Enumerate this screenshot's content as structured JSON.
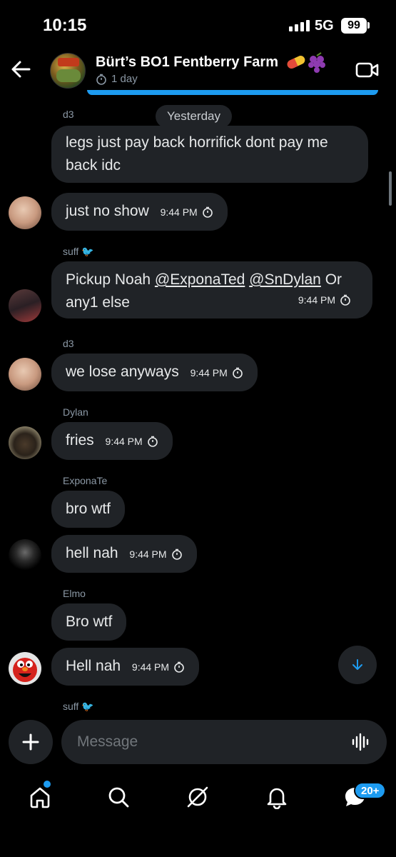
{
  "status_bar": {
    "time": "10:15",
    "network": "5G",
    "battery": "99"
  },
  "header": {
    "title": "Bürt’s BO1 Fentberry Farm",
    "subtitle": "1 day"
  },
  "date_separator": "Yesterday",
  "messages": [
    {
      "sender": "d3",
      "text": "legs just pay back horrifick dont pay me back idc"
    },
    {
      "text": "just no show",
      "time": "9:44 PM"
    },
    {
      "sender": "suff",
      "text_parts": [
        "Pickup Noah ",
        "@ExponaTed",
        " ",
        "@SnDylan",
        " Or any1 else"
      ],
      "time": "9:44 PM"
    },
    {
      "sender": "d3",
      "text": "we lose anyways",
      "time": "9:44 PM"
    },
    {
      "sender": "Dylan",
      "text": "fries",
      "time": "9:44 PM"
    },
    {
      "sender": "ExponaTe",
      "text": "bro wtf"
    },
    {
      "text": "hell nah",
      "time": "9:44 PM"
    },
    {
      "sender": "Elmo",
      "text": "Bro wtf"
    },
    {
      "text": "Hell nah",
      "time": "9:44 PM"
    },
    {
      "sender": "suff"
    }
  ],
  "composer": {
    "placeholder": "Message"
  },
  "tab_bar": {
    "badge": "20+"
  },
  "colors": {
    "accent": "#1d9bf0",
    "bubble": "#202327",
    "background": "#000000"
  }
}
